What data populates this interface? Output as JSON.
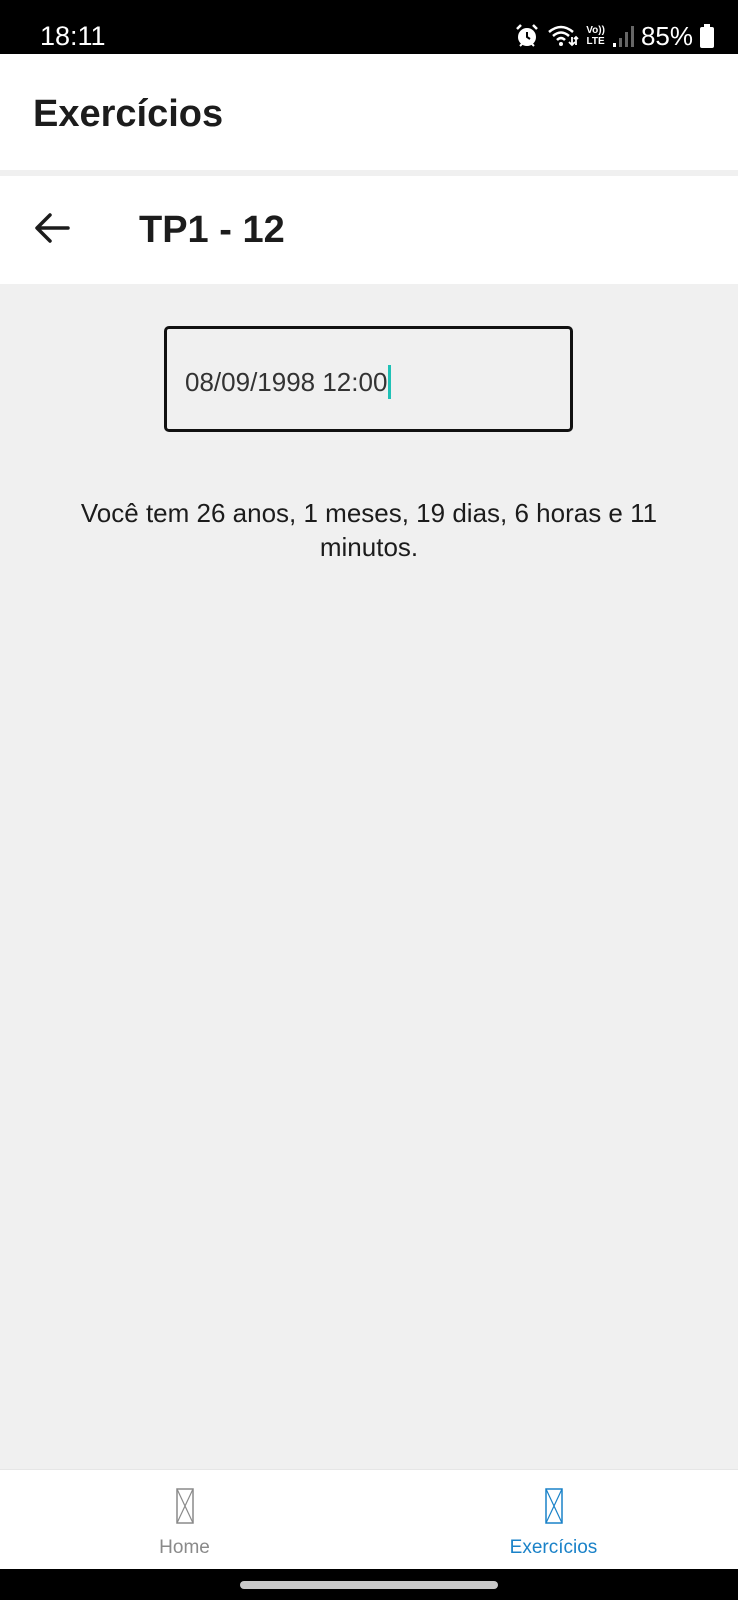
{
  "status_bar": {
    "time": "18:11",
    "battery": "85%",
    "icons": [
      "alarm-icon",
      "wifi-icon",
      "volte-icon",
      "signal-icon",
      "battery-icon"
    ],
    "volte_top": "Vo))",
    "volte_bottom": "LTE"
  },
  "header": {
    "title": "Exercícios"
  },
  "screen": {
    "back_icon": "arrow-left-icon",
    "title": "TP1 - 12"
  },
  "form": {
    "date_value": "08/09/1998 12:00",
    "cursor_color": "#1fc1b6"
  },
  "result": {
    "text": "Você tem 26 anos, 1 meses, 19 dias, 6 horas e 11 minutos."
  },
  "bottom_nav": {
    "items": [
      {
        "label": "Home",
        "icon": "placeholder-icon",
        "active": false
      },
      {
        "label": "Exercícios",
        "icon": "placeholder-icon",
        "active": true
      }
    ],
    "active_color": "#1a82c8",
    "inactive_color": "#8a8a8a"
  }
}
